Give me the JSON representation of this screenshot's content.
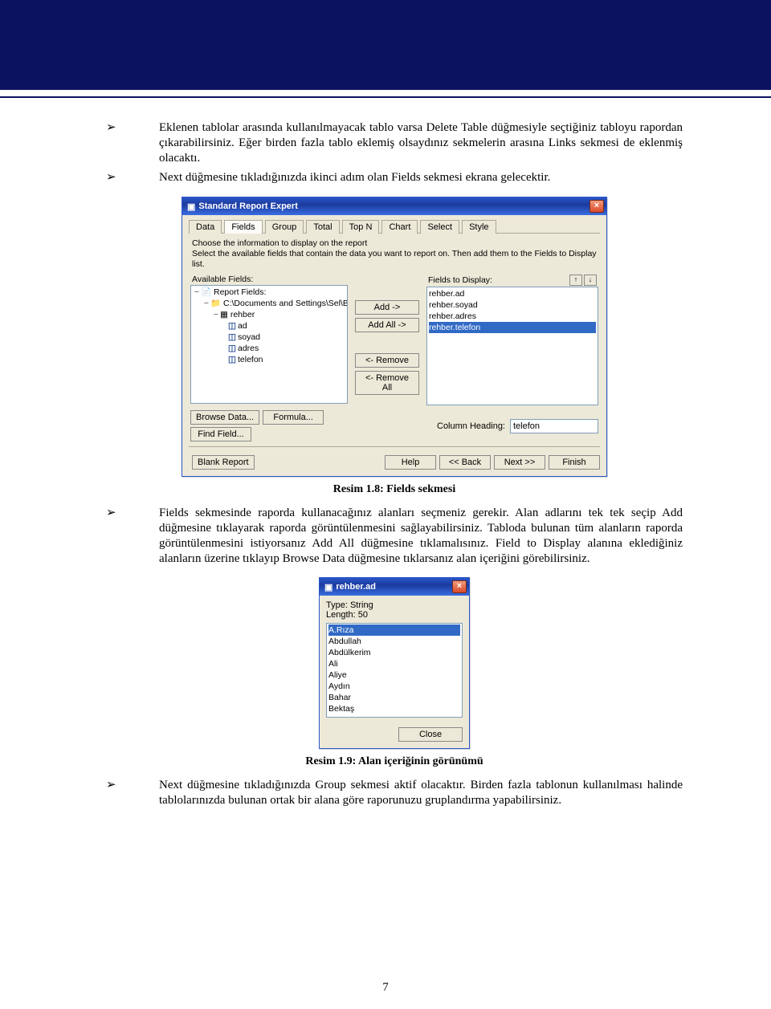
{
  "body": {
    "bullets_top": [
      "Eklenen tablolar arasında kullanılmayacak tablo varsa Delete Table düğmesiyle seçtiğiniz tabloyu rapordan çıkarabilirsiniz. Eğer birden fazla tablo eklemiş olsaydınız sekmelerin arasına Links sekmesi de eklenmiş olacaktı.",
      "Next düğmesine tıkladığınızda ikinci adım olan Fields sekmesi ekrana gelecektir."
    ],
    "caption1": "Resim 1.8: Fields sekmesi",
    "bullets_mid": [
      "Fields sekmesinde raporda kullanacağınız alanları seçmeniz gerekir. Alan adlarını tek tek seçip Add düğmesine tıklayarak raporda görüntülenmesini sağlayabilirsiniz. Tabloda bulunan tüm alanların raporda görüntülenmesini istiyorsanız Add All düğmesine tıklamalısınız. Field to Display alanına eklediğiniz alanların üzerine tıklayıp Browse Data düğmesine tıklarsanız alan içeriğini görebilirsiniz."
    ],
    "caption2": "Resim 1.9: Alan içeriğinin görünümü",
    "bullets_bottom": [
      "Next düğmesine tıkladığınızda Group sekmesi aktif olacaktır. Birden fazla tablonun kullanılması halinde tablolarınızda bulunan ortak bir alana göre raporunuzu gruplandırma yapabilirsiniz."
    ],
    "page_number": "7"
  },
  "dialog1": {
    "title": "Standard Report Expert",
    "tabs": [
      "Data",
      "Fields",
      "Group",
      "Total",
      "Top N",
      "Chart",
      "Select",
      "Style"
    ],
    "instr1": "Choose the information to display on the report",
    "instr2": "Select the available fields that contain the data you want to report on.  Then add them to the Fields to Display list.",
    "available_label": "Available Fields:",
    "display_label": "Fields to Display:",
    "tree": {
      "root": "Report Fields:",
      "path": "C:\\Documents and Settings\\Sel\\Be",
      "table": "rehber",
      "fields": [
        "ad",
        "soyad",
        "adres",
        "telefon"
      ]
    },
    "display_items": [
      "rehber.ad",
      "rehber.soyad",
      "rehber.adres",
      "rehber.telefon"
    ],
    "buttons_mid": [
      "Add ->",
      "Add All ->",
      "<- Remove",
      "<- Remove All"
    ],
    "browse": "Browse Data...",
    "formula": "Formula...",
    "find": "Find Field...",
    "col_heading_label": "Column Heading:",
    "col_heading_value": "telefon",
    "footer": {
      "blank": "Blank Report",
      "help": "Help",
      "back": "<< Back",
      "next": "Next >>",
      "finish": "Finish"
    }
  },
  "dialog2": {
    "title": "rehber.ad",
    "type_label": "Type: String",
    "length_label": "Length: 50",
    "items": [
      "A.Rıza",
      "Abdullah",
      "Abdülkerim",
      "Ali",
      "Aliye",
      "Aydın",
      "Bahar",
      "Bektaş"
    ],
    "close": "Close"
  }
}
